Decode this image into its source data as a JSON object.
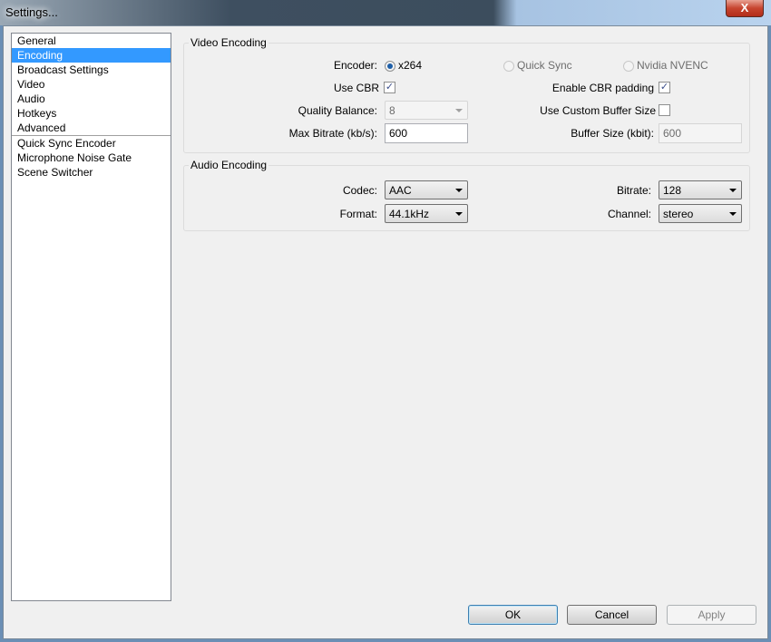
{
  "window": {
    "title": "Settings...",
    "close_label": "X"
  },
  "sidebar": {
    "items": [
      "General",
      "Encoding",
      "Broadcast Settings",
      "Video",
      "Audio",
      "Hotkeys",
      "Advanced",
      "Quick Sync Encoder",
      "Microphone Noise Gate",
      "Scene Switcher"
    ],
    "selected": "Encoding"
  },
  "video": {
    "title": "Video Encoding",
    "encoder_label": "Encoder:",
    "encoders": [
      "x264",
      "Quick Sync",
      "Nvidia NVENC"
    ],
    "encoder_selected": "x264",
    "use_cbr_label": "Use CBR",
    "use_cbr": true,
    "cbr_padding_label": "Enable CBR padding",
    "cbr_padding": true,
    "quality_label": "Quality Balance:",
    "quality_value": "8",
    "custom_buffer_label": "Use Custom Buffer Size",
    "custom_buffer": false,
    "max_bitrate_label": "Max Bitrate (kb/s):",
    "max_bitrate": "600",
    "buffer_size_label": "Buffer Size (kbit):",
    "buffer_size": "600"
  },
  "audio": {
    "title": "Audio Encoding",
    "codec_label": "Codec:",
    "codec": "AAC",
    "bitrate_label": "Bitrate:",
    "bitrate": "128",
    "format_label": "Format:",
    "format": "44.1kHz",
    "channel_label": "Channel:",
    "channel": "stereo"
  },
  "buttons": {
    "ok": "OK",
    "cancel": "Cancel",
    "apply": "Apply"
  },
  "check_mark": "✓"
}
